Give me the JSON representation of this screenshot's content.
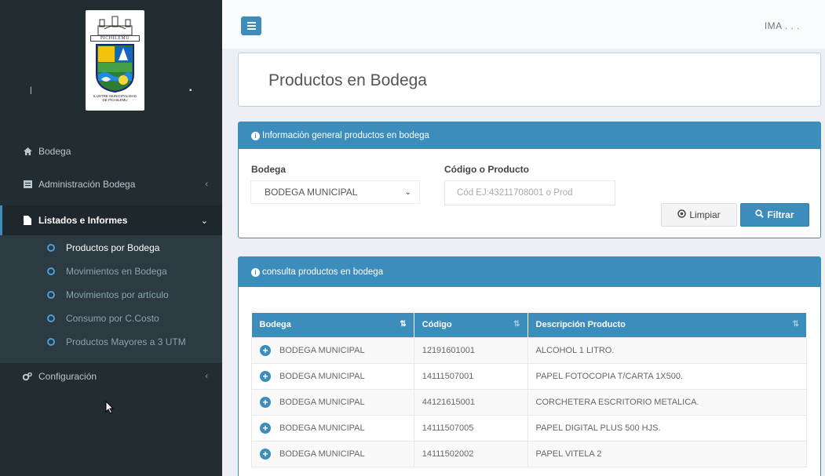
{
  "sidebar": {
    "logo": {
      "city_name": "PICHILEMU",
      "caption_line1": "ILUSTRE MUNICIPALIDAD",
      "caption_line2": "DE PICHILEMU"
    },
    "items": [
      {
        "label": "Bodega",
        "icon": "home-icon"
      },
      {
        "label": "Administración Bodega",
        "icon": "list-box-icon"
      },
      {
        "label": "Listados e Informes",
        "icon": "file-icon"
      },
      {
        "label": "Configuración",
        "icon": "cogs-icon"
      }
    ],
    "submenu": [
      {
        "label": "Productos por Bodega"
      },
      {
        "label": "Movimientos en Bodega"
      },
      {
        "label": "Movimientos por artículo"
      },
      {
        "label": "Consumo por C.Costo"
      },
      {
        "label": "Productos Mayores a 3 UTM"
      }
    ]
  },
  "topbar": {
    "user": "IMA . . ."
  },
  "page": {
    "title": "Productos en Bodega"
  },
  "filter_panel": {
    "header": "Información general productos en bodega",
    "bodega_label": "Bodega",
    "bodega_value": "BODEGA MUNICIPAL",
    "codigo_label": "Código o Producto",
    "codigo_placeholder": "Cód EJ:43211708001 o Prod",
    "clear_label": "Limpiar",
    "filter_label": "Filtrar"
  },
  "results_panel": {
    "header": "consulta productos en bodega",
    "columns": [
      "Bodega",
      "Código",
      "Descripción Producto"
    ],
    "rows": [
      {
        "bodega": "BODEGA MUNICIPAL",
        "codigo": "12191601001",
        "descripcion": "ALCOHOL 1 LITRO."
      },
      {
        "bodega": "BODEGA MUNICIPAL",
        "codigo": "14111507001",
        "descripcion": "PAPEL FOTOCOPIA T/CARTA 1X500."
      },
      {
        "bodega": "BODEGA MUNICIPAL",
        "codigo": "44121615001",
        "descripcion": "CORCHETERA ESCRITORIO METALICA."
      },
      {
        "bodega": "BODEGA MUNICIPAL",
        "codigo": "14111507005",
        "descripcion": "PAPEL DIGITAL PLUS 500 HJS."
      },
      {
        "bodega": "BODEGA MUNICIPAL",
        "codigo": "14111502002",
        "descripcion": "PAPEL VITELA 2"
      }
    ]
  },
  "colors": {
    "sidebar_bg": "#222d32",
    "accent": "#3c8dbc",
    "page_bg": "#ecf0f5"
  }
}
